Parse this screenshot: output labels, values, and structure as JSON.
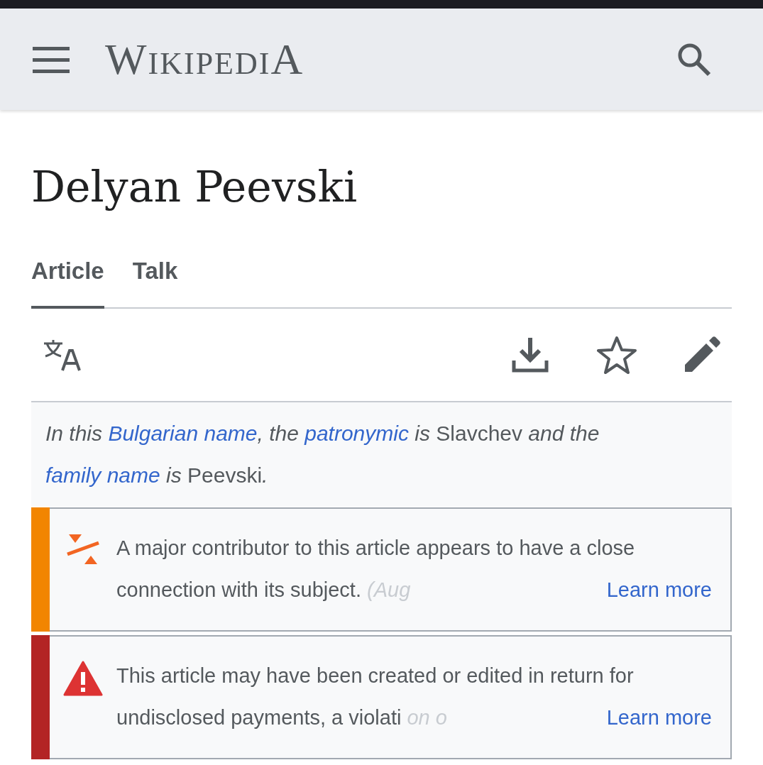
{
  "header": {
    "logo": "WIKIPEDIA"
  },
  "title": "Delyan Peevski",
  "tabs": [
    {
      "label": "Article",
      "selected": true
    },
    {
      "label": "Talk",
      "selected": false
    }
  ],
  "hatnote": [
    {
      "kind": "plain",
      "text": "In this "
    },
    {
      "kind": "link",
      "text": "Bulgarian name"
    },
    {
      "kind": "plain",
      "text": ", the "
    },
    {
      "kind": "link",
      "text": "patronymic"
    },
    {
      "kind": "plain",
      "text": " is "
    },
    {
      "kind": "name",
      "text": "Slavchev"
    },
    {
      "kind": "plain",
      "text": " and the "
    },
    {
      "kind": "link",
      "text": "family name"
    },
    {
      "kind": "plain",
      "text": " is "
    },
    {
      "kind": "name",
      "text": "Peevski"
    },
    {
      "kind": "plain",
      "text": "."
    }
  ],
  "notices": [
    {
      "kind": "coi",
      "color": "#f28500",
      "text": "A major contributor to this article appears to have a close connection with its subject.",
      "faded": "(Aug",
      "link": "Learn more"
    },
    {
      "kind": "paid",
      "color": "#b32424",
      "text": "This article may have been created or edited in return for undisclosed payments, a violati",
      "faded": "on o",
      "link": "Learn more"
    }
  ]
}
